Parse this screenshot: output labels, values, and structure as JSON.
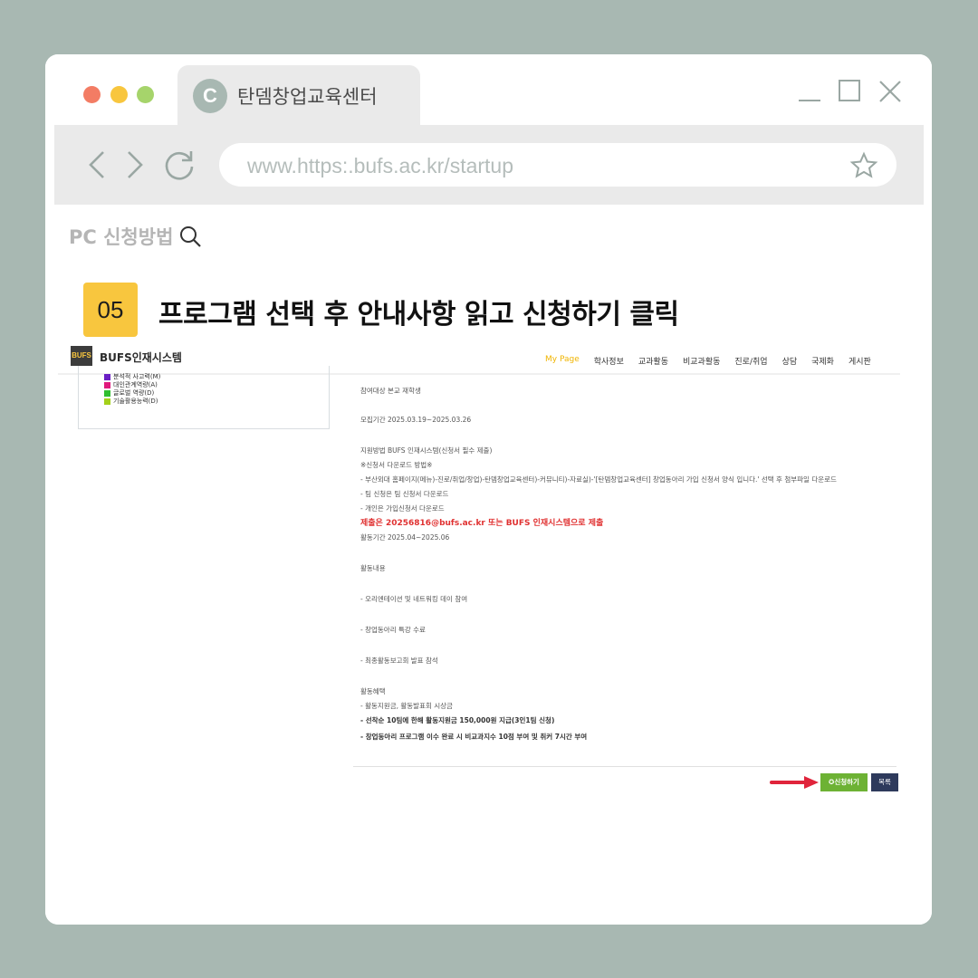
{
  "browser": {
    "tab_icon_letter": "C",
    "tab_title": "탄뎀창업교육센터",
    "url": "www.https:.bufs.ac.kr/startup"
  },
  "header": {
    "method_label": "PC 신청방법",
    "step_number": "05",
    "step_title": "프로그램 선택 후 안내사항 읽고 신청하기 클릭"
  },
  "site": {
    "logo_mark": "BUFS",
    "logo_name": "BUFS인재시스템",
    "menu": [
      "My Page",
      "학사정보",
      "교과활동",
      "비교과활동",
      "진로/취업",
      "상담",
      "국제화",
      "게시판"
    ],
    "legend": [
      {
        "label": "분석적 사고력(M)",
        "color": "#6a1fc4"
      },
      {
        "label": "대인관계역량(A)",
        "color": "#e0197d"
      },
      {
        "label": "글로벌 역량(D)",
        "color": "#2fbf2f"
      },
      {
        "label": "기술활용능력(D)",
        "color": "#a4d11a"
      }
    ]
  },
  "content": {
    "target": "참여대상 본교 재학생",
    "period": "모집기간 2025.03.19~2025.03.26",
    "apply_method": "지원방법 BUFS 인재시스템(신청서 필수 제출)",
    "download_title": "※신청서 다운로드 방법※",
    "download_1": "- 부산외대 홈페이지(메뉴)-진로/취업/창업)-탄뎀창업교육센터)-커뮤니티)-자료실)-'[탄뎀창업교육센터] 창업동아리 가입 신청서 양식 입니다.' 선택 후 첨부파일 다운로드",
    "download_2": "- 팀 신청은 팀 신청서 다운로드",
    "download_3": "- 개인은 가입신청서 다운로드",
    "submit": "제출은 20256816@bufs.ac.kr 또는 BUFS 인재시스템으로 제출",
    "activity_period": "활동기간 2025.04~2025.06",
    "activity_title": "활동내용",
    "activity_1": "- 오리엔테이션 및 네트워킹 데이 참여",
    "activity_2": "- 창업동아리 특강 수료",
    "activity_3": "- 최종활동보고회 발표 참석",
    "benefit_title": "활동혜택",
    "benefit_1": "- 활동지원금, 활동발표회 시상금",
    "benefit_2": "- 선착순 10팀에 한해 활동지원금 150,000원 지급(3인1팀 신청)",
    "benefit_3": "- 창업동아리 프로그램 이수 완료 시 비교과지수 10점 부여 및 취커 7시간 부여"
  },
  "buttons": {
    "apply": "✪신청하기",
    "list": "목록"
  },
  "colors": {
    "background": "#a8b8b2",
    "badge": "#f8c63e",
    "apply_button": "#6db234",
    "list_button": "#2e3a5c",
    "arrow": "#e0243b"
  }
}
